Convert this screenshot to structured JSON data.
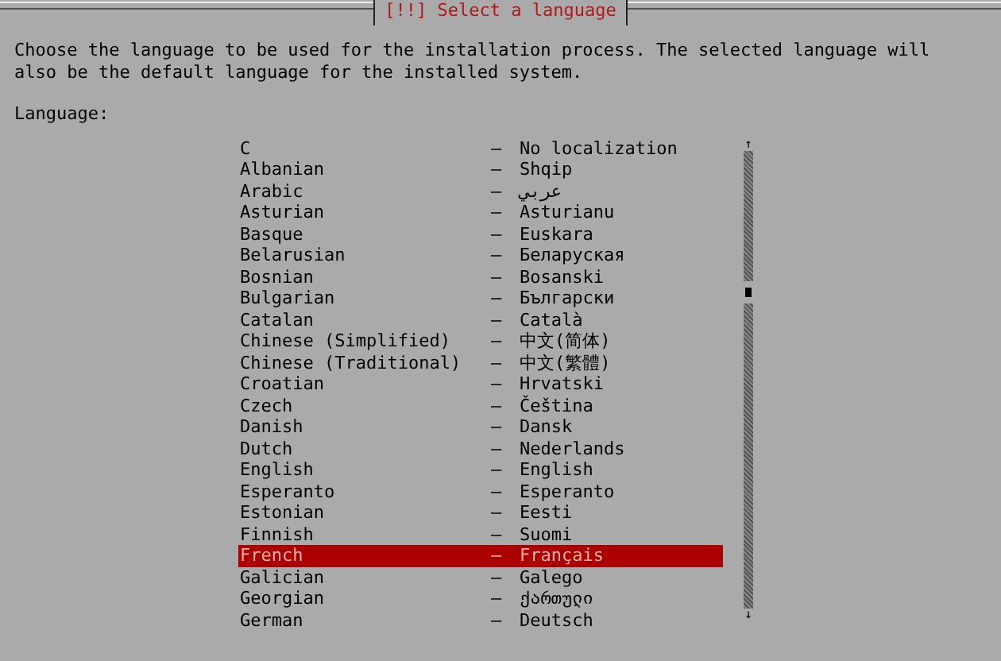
{
  "dialog": {
    "title": "[!!] Select a language",
    "description": "Choose the language to be used for the installation process. The selected language will also be the default language for the installed system.",
    "list_label": "Language:"
  },
  "languages": [
    {
      "name": "C",
      "separator": "–",
      "native": "No localization",
      "selected": false
    },
    {
      "name": "Albanian",
      "separator": "–",
      "native": "Shqip",
      "selected": false
    },
    {
      "name": "Arabic",
      "separator": "–",
      "native": "عربي",
      "selected": false
    },
    {
      "name": "Asturian",
      "separator": "–",
      "native": "Asturianu",
      "selected": false
    },
    {
      "name": "Basque",
      "separator": "–",
      "native": "Euskara",
      "selected": false
    },
    {
      "name": "Belarusian",
      "separator": "–",
      "native": "Беларуская",
      "selected": false
    },
    {
      "name": "Bosnian",
      "separator": "–",
      "native": "Bosanski",
      "selected": false
    },
    {
      "name": "Bulgarian",
      "separator": "–",
      "native": "Български",
      "selected": false
    },
    {
      "name": "Catalan",
      "separator": "–",
      "native": "Català",
      "selected": false
    },
    {
      "name": "Chinese (Simplified)",
      "separator": "–",
      "native": "中文(简体)",
      "selected": false
    },
    {
      "name": "Chinese (Traditional)",
      "separator": "–",
      "native": "中文(繁體)",
      "selected": false
    },
    {
      "name": "Croatian",
      "separator": "–",
      "native": "Hrvatski",
      "selected": false
    },
    {
      "name": "Czech",
      "separator": "–",
      "native": "Čeština",
      "selected": false
    },
    {
      "name": "Danish",
      "separator": "–",
      "native": "Dansk",
      "selected": false
    },
    {
      "name": "Dutch",
      "separator": "–",
      "native": "Nederlands",
      "selected": false
    },
    {
      "name": "English",
      "separator": "–",
      "native": "English",
      "selected": false
    },
    {
      "name": "Esperanto",
      "separator": "–",
      "native": "Esperanto",
      "selected": false
    },
    {
      "name": "Estonian",
      "separator": "–",
      "native": "Eesti",
      "selected": false
    },
    {
      "name": "Finnish",
      "separator": "–",
      "native": "Suomi",
      "selected": false
    },
    {
      "name": "French",
      "separator": "–",
      "native": "Français",
      "selected": true
    },
    {
      "name": "Galician",
      "separator": "–",
      "native": "Galego",
      "selected": false
    },
    {
      "name": "Georgian",
      "separator": "–",
      "native": "ქართული",
      "selected": false
    },
    {
      "name": "German",
      "separator": "–",
      "native": "Deutsch",
      "selected": false
    }
  ],
  "scrollbar": {
    "up_arrow": "↑",
    "down_arrow": "↓"
  }
}
